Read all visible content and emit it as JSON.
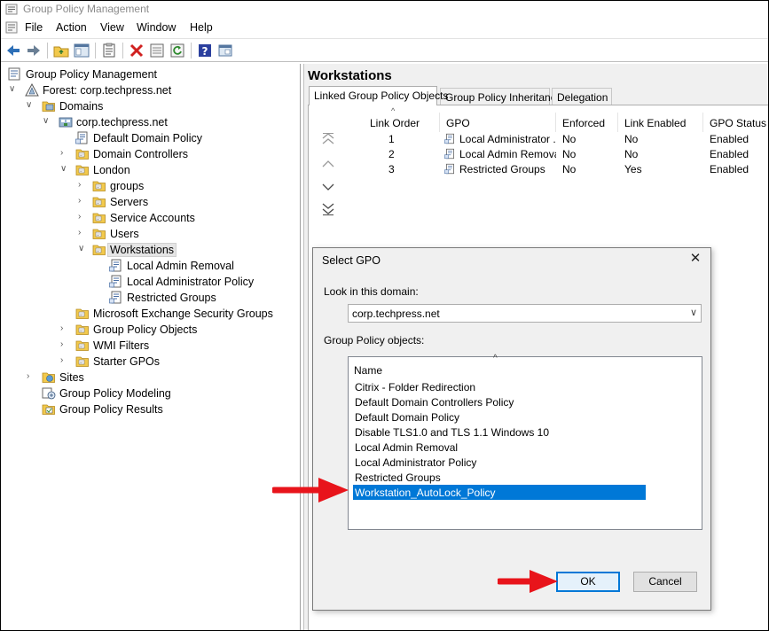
{
  "window": {
    "title": "Group Policy Management"
  },
  "menu": [
    "File",
    "Action",
    "View",
    "Window",
    "Help"
  ],
  "toolbar": {
    "icons": [
      "back-arrow-icon",
      "forward-arrow-icon",
      "up-folder-icon",
      "show-hide-tree-icon",
      "properties-icon",
      "delete-icon",
      "export-icon",
      "refresh-icon",
      "help-icon",
      "mmc-icon"
    ]
  },
  "tree": {
    "root": "Group Policy Management",
    "forest": "Forest: corp.techpress.net",
    "domains": "Domains",
    "domain": "corp.techpress.net",
    "default_domain_policy": "Default Domain Policy",
    "domain_controllers": "Domain Controllers",
    "london": "London",
    "groups": "groups",
    "servers": "Servers",
    "service_accounts": "Service Accounts",
    "users": "Users",
    "workstations": "Workstations",
    "link_local_admin_removal": "Local Admin Removal",
    "link_local_administrator_policy": "Local Administrator Policy",
    "link_restricted_groups": "Restricted Groups",
    "exchange_groups": "Microsoft Exchange Security Groups",
    "gpo_container": "Group Policy Objects",
    "wmi_filters": "WMI Filters",
    "starter_gpos": "Starter GPOs",
    "sites": "Sites",
    "modeling": "Group Policy Modeling",
    "results": "Group Policy Results"
  },
  "right": {
    "title": "Workstations",
    "tabs": [
      "Linked Group Policy Objects",
      "Group Policy Inheritance",
      "Delegation"
    ],
    "columns": [
      "Link Order",
      "GPO",
      "Enforced",
      "Link Enabled",
      "GPO Status"
    ],
    "rows": [
      {
        "order": "1",
        "gpo": "Local Administrator ...",
        "enforced": "No",
        "enabled": "No",
        "status": "Enabled"
      },
      {
        "order": "2",
        "gpo": "Local Admin Removal",
        "enforced": "No",
        "enabled": "No",
        "status": "Enabled"
      },
      {
        "order": "3",
        "gpo": "Restricted Groups",
        "enforced": "No",
        "enabled": "Yes",
        "status": "Enabled"
      }
    ]
  },
  "dialog": {
    "title": "Select GPO",
    "look_in_label": "Look in this domain:",
    "domain_value": "corp.techpress.net",
    "objects_label": "Group Policy objects:",
    "list_header": "Name",
    "items": [
      "Citrix - Folder Redirection",
      "Default Domain Controllers Policy",
      "Default Domain Policy",
      "Disable TLS1.0 and TLS 1.1 Windows 10",
      "Local Admin Removal",
      "Local Administrator Policy",
      "Restricted Groups",
      "Workstation_AutoLock_Policy"
    ],
    "selected_index": 7,
    "ok": "OK",
    "cancel": "Cancel"
  },
  "colors": {
    "selection": "#0078d7",
    "annotation_arrow": "#e8141b",
    "folder": "#e8b84a"
  }
}
